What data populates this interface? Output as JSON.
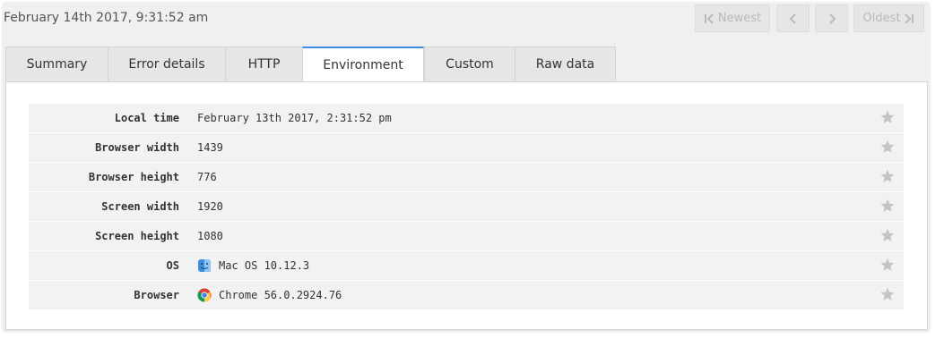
{
  "header": {
    "timestamp": "February 14th 2017, 9:31:52 am",
    "newest_label": "Newest",
    "oldest_label": "Oldest"
  },
  "tabs": [
    {
      "label": "Summary",
      "active": false
    },
    {
      "label": "Error details",
      "active": false
    },
    {
      "label": "HTTP",
      "active": false
    },
    {
      "label": "Environment",
      "active": true
    },
    {
      "label": "Custom",
      "active": false
    },
    {
      "label": "Raw data",
      "active": false
    }
  ],
  "environment": {
    "rows": [
      {
        "key": "Local time",
        "value": "February 13th 2017, 2:31:52 pm",
        "icon": null
      },
      {
        "key": "Browser width",
        "value": "1439",
        "icon": null
      },
      {
        "key": "Browser height",
        "value": "776",
        "icon": null
      },
      {
        "key": "Screen width",
        "value": "1920",
        "icon": null
      },
      {
        "key": "Screen height",
        "value": "1080",
        "icon": null
      },
      {
        "key": "OS",
        "value": "Mac OS 10.12.3",
        "icon": "mac-finder-icon"
      },
      {
        "key": "Browser",
        "value": "Chrome 56.0.2924.76",
        "icon": "chrome-icon"
      }
    ]
  },
  "colors": {
    "active_tab_accent": "#3b8ee0",
    "star": "#c4c4c4"
  }
}
